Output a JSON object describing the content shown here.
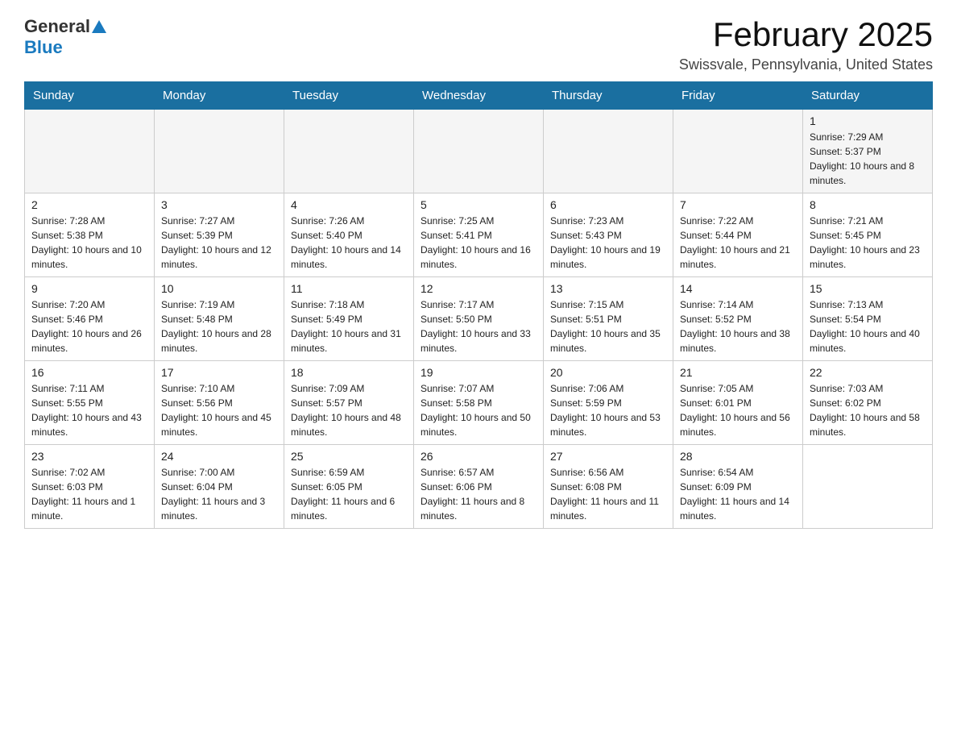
{
  "header": {
    "logo": {
      "general": "General",
      "blue": "Blue"
    },
    "title": "February 2025",
    "subtitle": "Swissvale, Pennsylvania, United States"
  },
  "calendar": {
    "days_of_week": [
      "Sunday",
      "Monday",
      "Tuesday",
      "Wednesday",
      "Thursday",
      "Friday",
      "Saturday"
    ],
    "weeks": [
      [
        {
          "day": "",
          "info": ""
        },
        {
          "day": "",
          "info": ""
        },
        {
          "day": "",
          "info": ""
        },
        {
          "day": "",
          "info": ""
        },
        {
          "day": "",
          "info": ""
        },
        {
          "day": "",
          "info": ""
        },
        {
          "day": "1",
          "info": "Sunrise: 7:29 AM\nSunset: 5:37 PM\nDaylight: 10 hours and 8 minutes."
        }
      ],
      [
        {
          "day": "2",
          "info": "Sunrise: 7:28 AM\nSunset: 5:38 PM\nDaylight: 10 hours and 10 minutes."
        },
        {
          "day": "3",
          "info": "Sunrise: 7:27 AM\nSunset: 5:39 PM\nDaylight: 10 hours and 12 minutes."
        },
        {
          "day": "4",
          "info": "Sunrise: 7:26 AM\nSunset: 5:40 PM\nDaylight: 10 hours and 14 minutes."
        },
        {
          "day": "5",
          "info": "Sunrise: 7:25 AM\nSunset: 5:41 PM\nDaylight: 10 hours and 16 minutes."
        },
        {
          "day": "6",
          "info": "Sunrise: 7:23 AM\nSunset: 5:43 PM\nDaylight: 10 hours and 19 minutes."
        },
        {
          "day": "7",
          "info": "Sunrise: 7:22 AM\nSunset: 5:44 PM\nDaylight: 10 hours and 21 minutes."
        },
        {
          "day": "8",
          "info": "Sunrise: 7:21 AM\nSunset: 5:45 PM\nDaylight: 10 hours and 23 minutes."
        }
      ],
      [
        {
          "day": "9",
          "info": "Sunrise: 7:20 AM\nSunset: 5:46 PM\nDaylight: 10 hours and 26 minutes."
        },
        {
          "day": "10",
          "info": "Sunrise: 7:19 AM\nSunset: 5:48 PM\nDaylight: 10 hours and 28 minutes."
        },
        {
          "day": "11",
          "info": "Sunrise: 7:18 AM\nSunset: 5:49 PM\nDaylight: 10 hours and 31 minutes."
        },
        {
          "day": "12",
          "info": "Sunrise: 7:17 AM\nSunset: 5:50 PM\nDaylight: 10 hours and 33 minutes."
        },
        {
          "day": "13",
          "info": "Sunrise: 7:15 AM\nSunset: 5:51 PM\nDaylight: 10 hours and 35 minutes."
        },
        {
          "day": "14",
          "info": "Sunrise: 7:14 AM\nSunset: 5:52 PM\nDaylight: 10 hours and 38 minutes."
        },
        {
          "day": "15",
          "info": "Sunrise: 7:13 AM\nSunset: 5:54 PM\nDaylight: 10 hours and 40 minutes."
        }
      ],
      [
        {
          "day": "16",
          "info": "Sunrise: 7:11 AM\nSunset: 5:55 PM\nDaylight: 10 hours and 43 minutes."
        },
        {
          "day": "17",
          "info": "Sunrise: 7:10 AM\nSunset: 5:56 PM\nDaylight: 10 hours and 45 minutes."
        },
        {
          "day": "18",
          "info": "Sunrise: 7:09 AM\nSunset: 5:57 PM\nDaylight: 10 hours and 48 minutes."
        },
        {
          "day": "19",
          "info": "Sunrise: 7:07 AM\nSunset: 5:58 PM\nDaylight: 10 hours and 50 minutes."
        },
        {
          "day": "20",
          "info": "Sunrise: 7:06 AM\nSunset: 5:59 PM\nDaylight: 10 hours and 53 minutes."
        },
        {
          "day": "21",
          "info": "Sunrise: 7:05 AM\nSunset: 6:01 PM\nDaylight: 10 hours and 56 minutes."
        },
        {
          "day": "22",
          "info": "Sunrise: 7:03 AM\nSunset: 6:02 PM\nDaylight: 10 hours and 58 minutes."
        }
      ],
      [
        {
          "day": "23",
          "info": "Sunrise: 7:02 AM\nSunset: 6:03 PM\nDaylight: 11 hours and 1 minute."
        },
        {
          "day": "24",
          "info": "Sunrise: 7:00 AM\nSunset: 6:04 PM\nDaylight: 11 hours and 3 minutes."
        },
        {
          "day": "25",
          "info": "Sunrise: 6:59 AM\nSunset: 6:05 PM\nDaylight: 11 hours and 6 minutes."
        },
        {
          "day": "26",
          "info": "Sunrise: 6:57 AM\nSunset: 6:06 PM\nDaylight: 11 hours and 8 minutes."
        },
        {
          "day": "27",
          "info": "Sunrise: 6:56 AM\nSunset: 6:08 PM\nDaylight: 11 hours and 11 minutes."
        },
        {
          "day": "28",
          "info": "Sunrise: 6:54 AM\nSunset: 6:09 PM\nDaylight: 11 hours and 14 minutes."
        },
        {
          "day": "",
          "info": ""
        }
      ]
    ]
  }
}
